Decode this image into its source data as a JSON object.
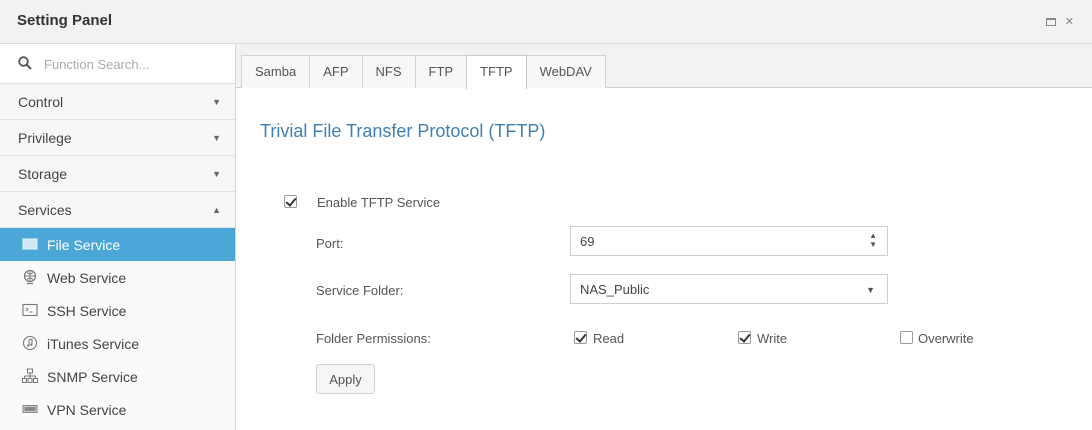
{
  "window": {
    "title": "Setting Panel"
  },
  "sidebar": {
    "search_placeholder": "Function Search...",
    "categories": [
      {
        "label": "Control",
        "expanded": false
      },
      {
        "label": "Privilege",
        "expanded": false
      },
      {
        "label": "Storage",
        "expanded": false
      },
      {
        "label": "Services",
        "expanded": true
      }
    ],
    "services": [
      {
        "label": "File Service",
        "icon": "file-service-icon",
        "active": true
      },
      {
        "label": "Web Service",
        "icon": "globe-icon",
        "active": false
      },
      {
        "label": "SSH Service",
        "icon": "terminal-icon",
        "active": false
      },
      {
        "label": "iTunes Service",
        "icon": "music-note-icon",
        "active": false
      },
      {
        "label": "SNMP Service",
        "icon": "network-tree-icon",
        "active": false
      },
      {
        "label": "VPN Service",
        "icon": "vpn-icon",
        "active": false
      }
    ]
  },
  "tabs": [
    "Samba",
    "AFP",
    "NFS",
    "FTP",
    "TFTP",
    "WebDAV"
  ],
  "active_tab": "TFTP",
  "content": {
    "heading": "Trivial File Transfer Protocol (TFTP)",
    "enable_label": "Enable TFTP Service",
    "enable_checked": true,
    "port_label": "Port:",
    "port_value": "69",
    "folder_label": "Service Folder:",
    "folder_value": "NAS_Public",
    "permissions_label": "Folder Permissions:",
    "permissions": [
      {
        "label": "Read",
        "checked": true
      },
      {
        "label": "Write",
        "checked": true
      },
      {
        "label": "Overwrite",
        "checked": false
      }
    ],
    "apply_label": "Apply"
  },
  "colors": {
    "accent": "#4ba7d8",
    "heading": "#3f7fb3"
  }
}
